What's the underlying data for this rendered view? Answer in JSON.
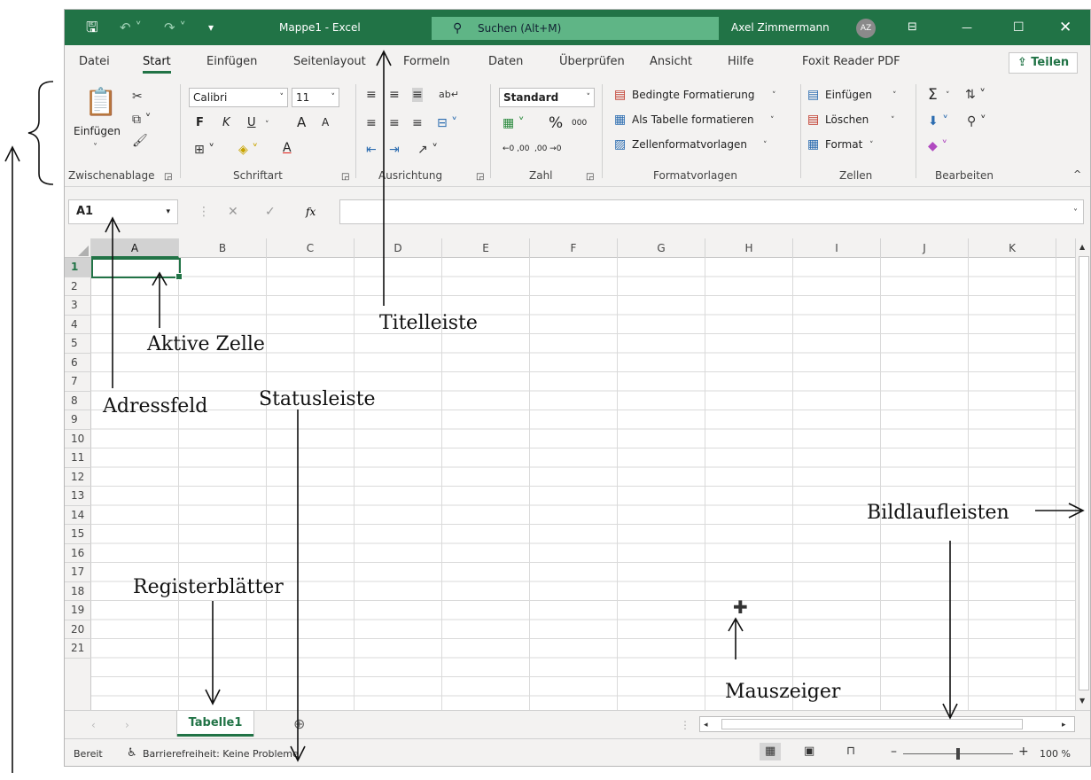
{
  "titlebar": {
    "title": "Mappe1 - Excel",
    "search": "Suchen (Alt+M)",
    "user": "Axel Zimmermann",
    "avatar": "AZ",
    "icons": [
      "save-icon",
      "undo-icon",
      "redo-icon",
      "customize-icon",
      "search-icon",
      "ribbon-display-icon",
      "minimize-icon",
      "maximize-icon",
      "close-icon"
    ]
  },
  "tabs": [
    "Datei",
    "Start",
    "Einfügen",
    "Seitenlayout",
    "Formeln",
    "Daten",
    "Überprüfen",
    "Ansicht",
    "Hilfe",
    "Foxit Reader PDF"
  ],
  "active_tab": "Start",
  "share": "Teilen",
  "ribbon": {
    "paste": "Einfügen",
    "group_clipboard": "Zwischenablage",
    "font_name": "Calibri",
    "font_size": "11",
    "bold": "F",
    "italic": "K",
    "underline": "U",
    "grow_font": "A",
    "shrink_font": "A",
    "font_color": "A",
    "group_font": "Schriftart",
    "group_alignment": "Ausrichtung",
    "number_format": "Standard",
    "percent": "%",
    "thousands": "000",
    "dec_inc": "←0 ,00",
    "dec_dec": ",00 →0",
    "group_number": "Zahl",
    "cond_format": "Bedingte Formatierung",
    "as_table": "Als Tabelle formatieren",
    "cell_styles": "Zellenformatvorlagen",
    "group_styles": "Formatvorlagen",
    "insert": "Einfügen",
    "delete": "Löschen",
    "format": "Format",
    "group_cells": "Zellen",
    "group_edit": "Bearbeiten",
    "sum": "Σ",
    "fx": "fx"
  },
  "formula": {
    "namebox": "A1",
    "value": ""
  },
  "columns": [
    "A",
    "B",
    "C",
    "D",
    "E",
    "F",
    "G",
    "H",
    "I",
    "J",
    "K"
  ],
  "rows": [
    "1",
    "2",
    "3",
    "4",
    "5",
    "6",
    "7",
    "8",
    "9",
    "10",
    "11",
    "12",
    "13",
    "14",
    "15",
    "16",
    "17",
    "18",
    "19",
    "20",
    "21"
  ],
  "sheet": "Tabelle1",
  "status": {
    "ready": "Bereit",
    "accessibility": "Barrierefreiheit: Keine Probleme",
    "zoom": "100 %"
  },
  "annotations": {
    "titelleiste": "Titelleiste",
    "aktive_zelle": "Aktive Zelle",
    "adressfeld": "Adressfeld",
    "statusleiste": "Statusleiste",
    "bildlaufleisten": "Bildlaufleisten",
    "registerblaetter": "Registerblätter",
    "mauszeiger": "Mauszeiger"
  },
  "colors": {
    "accent": "#217346",
    "search": "#5fb586"
  }
}
